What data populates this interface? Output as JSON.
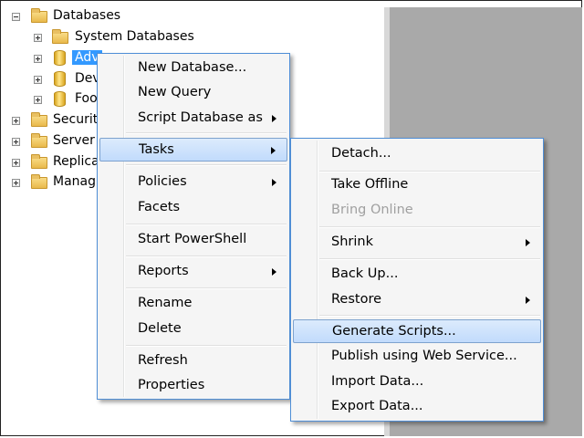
{
  "tree": {
    "databases": "Databases",
    "system_databases": "System Databases",
    "db1": "Adv",
    "db2": "Dev",
    "db3": "Foo",
    "security": "Securit",
    "server": "Server",
    "replication": "Replica",
    "management": "Manag"
  },
  "menu1": {
    "new_database": "New Database...",
    "new_query": "New Query",
    "script_database_as": "Script Database as",
    "tasks": "Tasks",
    "policies": "Policies",
    "facets": "Facets",
    "start_powershell": "Start PowerShell",
    "reports": "Reports",
    "rename": "Rename",
    "delete": "Delete",
    "refresh": "Refresh",
    "properties": "Properties"
  },
  "menu2": {
    "detach": "Detach...",
    "take_offline": "Take Offline",
    "bring_online": "Bring Online",
    "shrink": "Shrink",
    "back_up": "Back Up...",
    "restore": "Restore",
    "generate_scripts": "Generate Scripts...",
    "publish_web": "Publish using Web Service...",
    "import_data": "Import Data...",
    "export_data": "Export Data..."
  },
  "colors": {
    "selection": "#3399ff",
    "menu_border": "#4f8ed6",
    "highlight": "#c1dbfc",
    "panel": "#a9a9a9"
  }
}
